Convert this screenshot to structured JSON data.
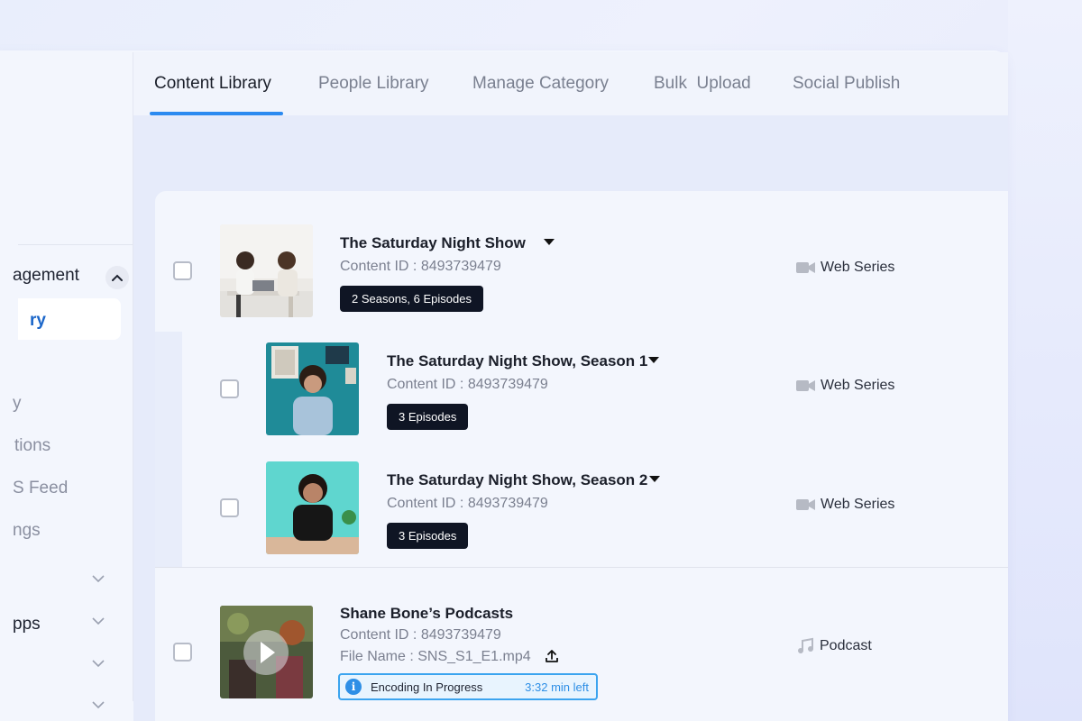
{
  "sidebar": {
    "section_label": "agement",
    "active_item": "ry",
    "items": [
      "y",
      "tions",
      "S Feed",
      "ngs"
    ],
    "apps_label": "pps"
  },
  "tabs": [
    {
      "label": "Content Library",
      "active": true
    },
    {
      "label": "People Library",
      "active": false
    },
    {
      "label": "Manage Category",
      "active": false
    },
    {
      "label": "Bulk  Upload",
      "active": false
    },
    {
      "label": "Social Publish",
      "active": false
    }
  ],
  "rows": [
    {
      "title": "The Saturday Night Show",
      "content_id": "Content ID : 8493739479",
      "badge": "2 Seasons, 6 Episodes",
      "type": "Web Series",
      "type_icon": "video-camera-icon"
    },
    {
      "title": "The Saturday Night Show, Season 1",
      "content_id": "Content ID : 8493739479",
      "badge": "3 Episodes",
      "type": "Web Series",
      "type_icon": "video-camera-icon"
    },
    {
      "title": "The Saturday Night Show, Season 2",
      "content_id": "Content ID : 8493739479",
      "badge": "3 Episodes",
      "type": "Web Series",
      "type_icon": "video-camera-icon"
    },
    {
      "title": "Shane Bone’s Podcasts",
      "content_id": "Content ID : 8493739479",
      "file_name": "File Name : SNS_S1_E1.mp4",
      "type": "Podcast",
      "type_icon": "music-note-icon",
      "encoding_status": "Encoding In Progress",
      "encoding_time_left": "3:32 min left"
    }
  ],
  "colors": {
    "accent": "#2b8af0",
    "badge_bg": "#0f1524",
    "encoding_border": "#3ba4ef"
  }
}
